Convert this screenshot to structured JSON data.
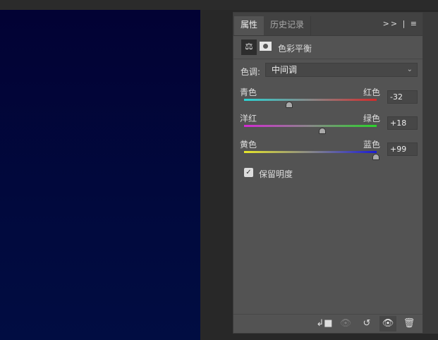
{
  "tabs": {
    "properties": "属性",
    "history": "历史记录",
    "expand_icon": ">>",
    "menu_icon": "≡"
  },
  "header": {
    "title": "色彩平衡",
    "adjustment_icon": "balance-scale",
    "mask_icon": "mask"
  },
  "tone": {
    "label": "色调:",
    "value": "中间调"
  },
  "sliders": [
    {
      "left": "青色",
      "right": "红色",
      "value": "-32",
      "num": -32,
      "from": "#2ad4d4",
      "to": "#d42a2a"
    },
    {
      "left": "洋红",
      "right": "绿色",
      "value": "+18",
      "num": 18,
      "from": "#d42ad4",
      "to": "#2ad42a"
    },
    {
      "left": "黄色",
      "right": "蓝色",
      "value": "+99",
      "num": 99,
      "from": "#e6e62a",
      "to": "#1a1ad4"
    }
  ],
  "preserve_luminosity": {
    "label": "保留明度",
    "checked": true
  },
  "footer": {
    "clip": "clip-to-layer",
    "view_previous": "view-previous",
    "reset": "reset",
    "visibility": "visibility",
    "delete": "delete"
  }
}
